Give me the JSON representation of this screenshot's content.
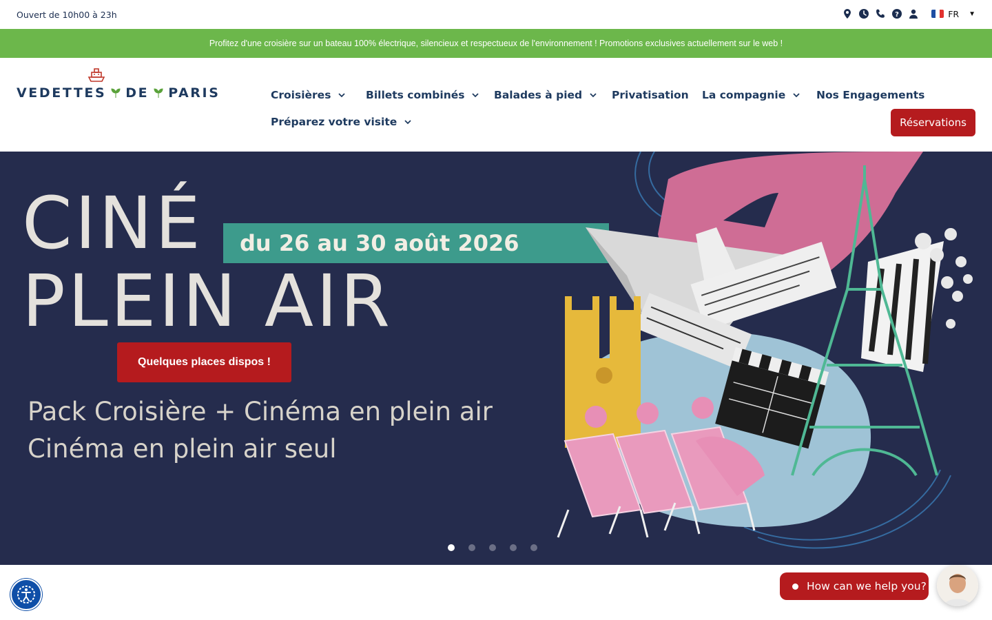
{
  "topbar": {
    "hours": "Ouvert de 10h00 à 23h",
    "icons": [
      "location-icon",
      "clock-icon",
      "phone-icon",
      "help-icon",
      "user-icon"
    ],
    "language": "FR",
    "flag_colors": [
      "#1f4fa3",
      "#ffffff",
      "#e2322e"
    ]
  },
  "promo": {
    "text": "Profitez d'une croisière sur un bateau 100% électrique, silencieux et respectueux de l'environnement ! Promotions exclusives actuellement sur le web !",
    "bg_color": "#6cb74b"
  },
  "logo": {
    "word1": "VEDETTES",
    "word2": "DE",
    "word3": "PARIS",
    "boat_color": "#c0392b",
    "leaf_color": "#5aa23a"
  },
  "nav": {
    "items": [
      {
        "label": "Croisières",
        "dropdown": true
      },
      {
        "label": "Billets combinés",
        "dropdown": true
      },
      {
        "label": "Balades à pied",
        "dropdown": true
      },
      {
        "label": "Privatisation",
        "dropdown": false
      },
      {
        "label": "La compagnie",
        "dropdown": true
      },
      {
        "label": "Nos Engagements",
        "dropdown": false
      },
      {
        "label": "Préparez votre visite",
        "dropdown": true
      }
    ],
    "cta": "Réservations",
    "cta_color": "#b51b1e"
  },
  "hero": {
    "title_line1": "CINÉ",
    "title_line2": "PLEIN AIR",
    "dates": "du 26 au 30 août 2026",
    "button": "Quelques places dispos !",
    "subtitle1": "Pack Croisière + Cinéma en plein air",
    "subtitle2": "Cinéma en plein air seul",
    "bg_color": "#252c4d",
    "slides": 5,
    "active_slide": 1
  },
  "widgets": {
    "chat_prompt": "How can we help you?"
  }
}
